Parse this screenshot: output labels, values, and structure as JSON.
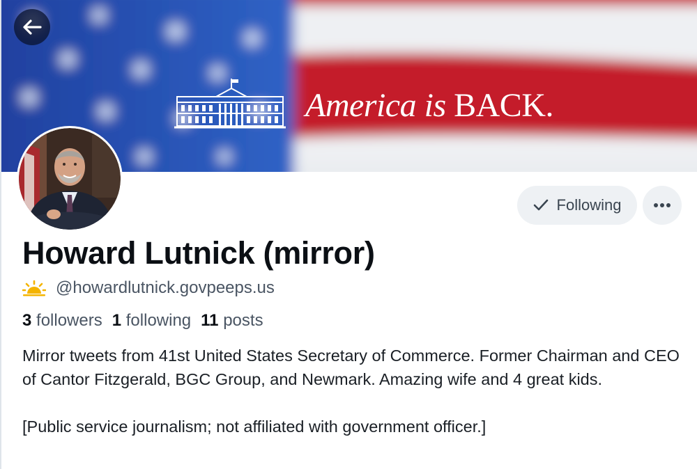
{
  "banner": {
    "headline_italic": "America is ",
    "headline_plain": "BACK.",
    "colors": {
      "blue": "#2a58b8",
      "red": "#c8202c",
      "white": "#f2f3f5"
    }
  },
  "nav": {
    "back_icon": "arrow-left-icon"
  },
  "profile": {
    "display_name": "Howard Lutnick (mirror)",
    "handle": "@howardlutnick.govpeeps.us",
    "handle_icon": "sunrise-icon",
    "stats": [
      {
        "value": "3",
        "label": "followers"
      },
      {
        "value": "1",
        "label": "following"
      },
      {
        "value": "11",
        "label": "posts"
      }
    ],
    "bio_paragraphs": [
      "Mirror tweets from 41st United States Secretary of Commerce. Former Chairman and CEO of Cantor Fitzgerald, BGC Group, and Newmark. Amazing wife and 4 great kids.",
      "[Public service journalism; not affiliated with government officer.]"
    ]
  },
  "actions": {
    "following_label": "Following",
    "following_icon": "checkmark-icon",
    "more_icon": "ellipsis-icon"
  }
}
